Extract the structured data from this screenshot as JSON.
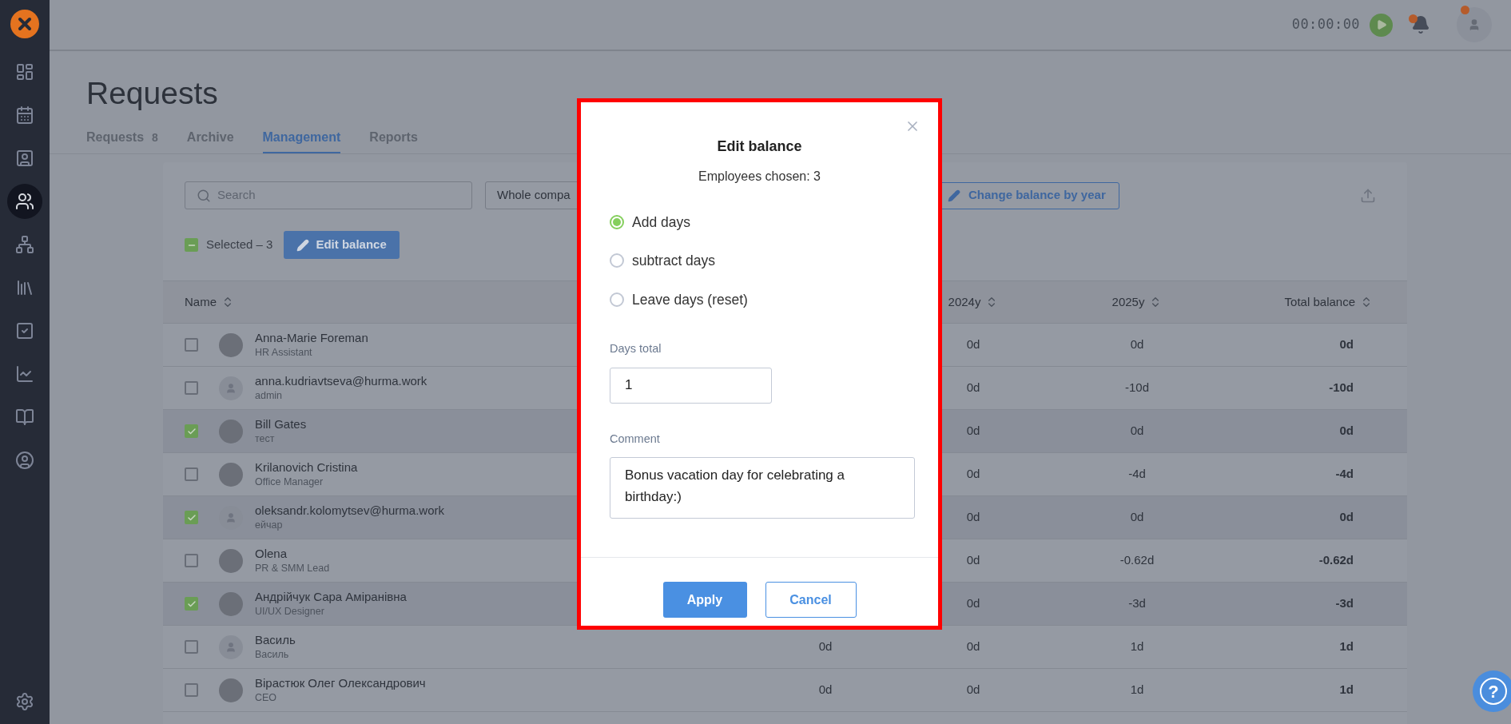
{
  "sidebar": {
    "items": [
      {
        "selected": false
      },
      {
        "selected": false
      },
      {
        "selected": false
      },
      {
        "selected": true
      },
      {
        "selected": false
      },
      {
        "selected": false
      },
      {
        "selected": false
      },
      {
        "selected": false
      },
      {
        "selected": false
      },
      {
        "selected": false
      }
    ]
  },
  "header": {
    "timer": "00:00:00",
    "notification_dot": true,
    "avatar_dot": true
  },
  "page": {
    "title": "Requests"
  },
  "tabs": [
    {
      "label": "Requests",
      "count": "8",
      "selected": false
    },
    {
      "label": "Archive",
      "selected": false
    },
    {
      "label": "Management",
      "selected": true
    },
    {
      "label": "Reports",
      "selected": false
    }
  ],
  "toolbar": {
    "search": {
      "placeholder": "Search"
    },
    "filter": "Whole compa",
    "change_button": "Change balance by year"
  },
  "selection": {
    "indeterminate": true,
    "label": "Selected – 3",
    "button": "Edit balance"
  },
  "help": {
    "label": "?"
  },
  "table": {
    "columns": [
      {
        "label": "Name"
      },
      {},
      {
        "label": "2024y"
      },
      {
        "label": "2025y"
      },
      {
        "label": "Total balance"
      }
    ],
    "rows": [
      {
        "name": "Anna-Marie Foreman",
        "role": "HR Assistant",
        "photo": true,
        "checked": false,
        "y2024": "0d",
        "y2025": "0d",
        "total": "0d"
      },
      {
        "name": "anna.kudriavtseva@hurma.work",
        "role": "admin",
        "photo": false,
        "checked": false,
        "y2024": "0d",
        "y2025": "-10d",
        "total": "-10d"
      },
      {
        "name": "Bill Gates",
        "role": "тест",
        "photo": true,
        "checked": true,
        "y2024": "0d",
        "y2025": "0d",
        "total": "0d"
      },
      {
        "name": "Krilanovich Cristina",
        "role": "Office Manager",
        "photo": true,
        "checked": false,
        "y2024": "0d",
        "y2025": "-4d",
        "total": "-4d"
      },
      {
        "name": "oleksandr.kolomytsev@hurma.work",
        "role": "ейчар",
        "photo": false,
        "checked": true,
        "y2024": "0d",
        "y2025": "0d",
        "total": "0d"
      },
      {
        "name": "Olena",
        "role": "PR & SMM Lead",
        "photo": true,
        "checked": false,
        "y2024": "0d",
        "y2025": "-0.62d",
        "total": "-0.62d"
      },
      {
        "name": "Андрійчук Сара Аміранівна",
        "role": "UI/UX Designer",
        "photo": true,
        "checked": true,
        "y2024": "0d",
        "y2025": "-3d",
        "total": "-3d"
      },
      {
        "name": "Василь",
        "role": "Василь",
        "photo": false,
        "checked": false,
        "column_2": "0d",
        "y2024": "0d",
        "y2025": "1d",
        "total": "1d"
      },
      {
        "name": "Вірастюк Олег Олександрович",
        "role": "CEO",
        "photo": true,
        "checked": false,
        "column_2": "0d",
        "y2024": "0d",
        "y2025": "1d",
        "total": "1d"
      }
    ]
  },
  "modal": {
    "title": "Edit balance",
    "subtitle": "Employees chosen: 3",
    "options": [
      {
        "label": "Add days",
        "selected": true
      },
      {
        "label": "subtract days",
        "selected": false
      },
      {
        "label": "Leave days (reset)",
        "selected": false
      }
    ],
    "days_label": "Days total",
    "days_value": "1",
    "comment_label": "Comment",
    "comment_value": "Bonus vacation day for celebrating a birthday:)",
    "buttons": [
      {
        "label": "Apply",
        "kind": "primary"
      },
      {
        "label": "Cancel",
        "kind": "secondary"
      }
    ]
  }
}
